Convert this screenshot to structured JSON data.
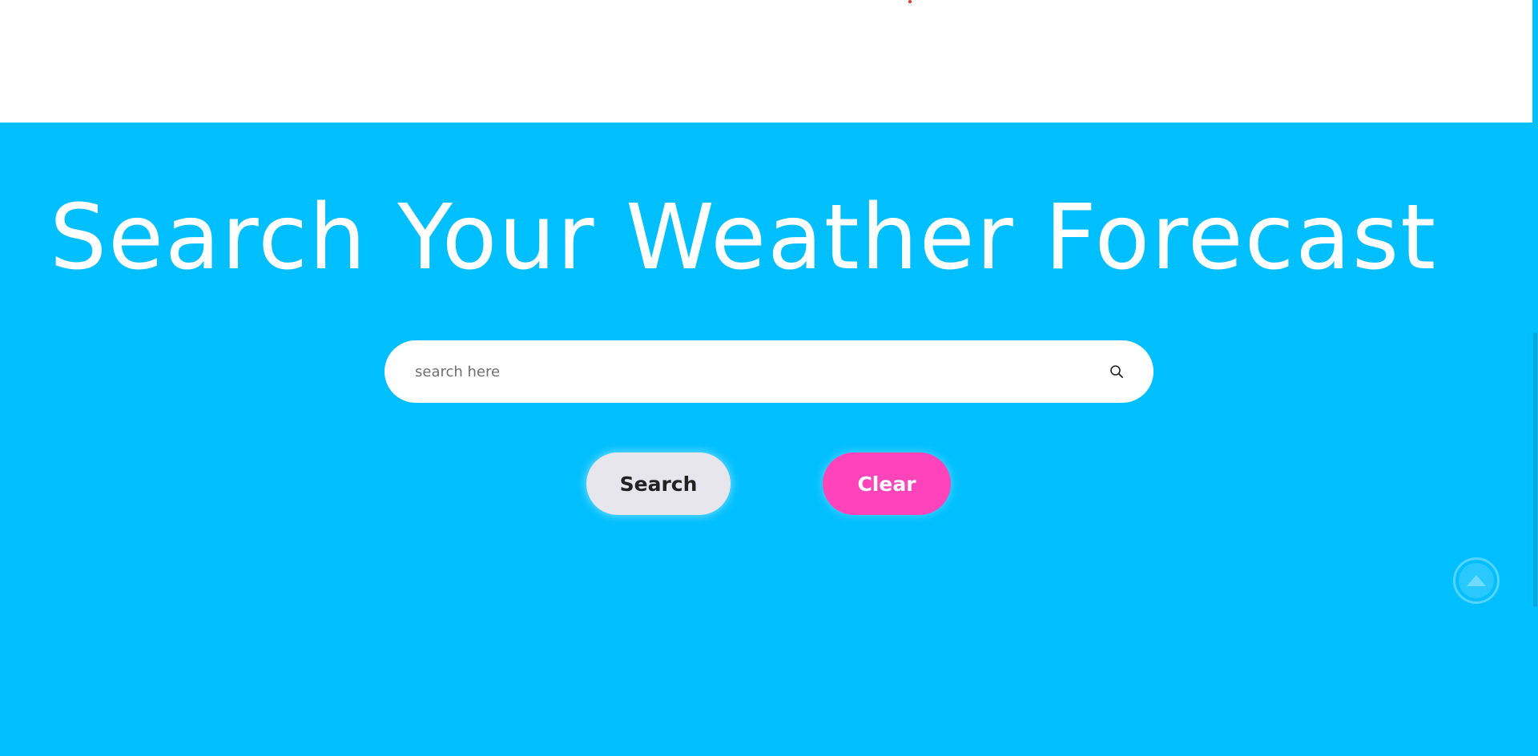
{
  "hero": {
    "title": "Search Your Weather Forecast"
  },
  "search": {
    "placeholder": "search here",
    "value": "",
    "icon": "search-icon"
  },
  "buttons": {
    "search_label": "Search",
    "clear_label": "Clear"
  },
  "scroll_top": {
    "icon": "arrow-up-icon"
  },
  "colors": {
    "hero_background": "#00bfff",
    "search_button": "#e6e6ec",
    "clear_button": "#ff44bb"
  }
}
